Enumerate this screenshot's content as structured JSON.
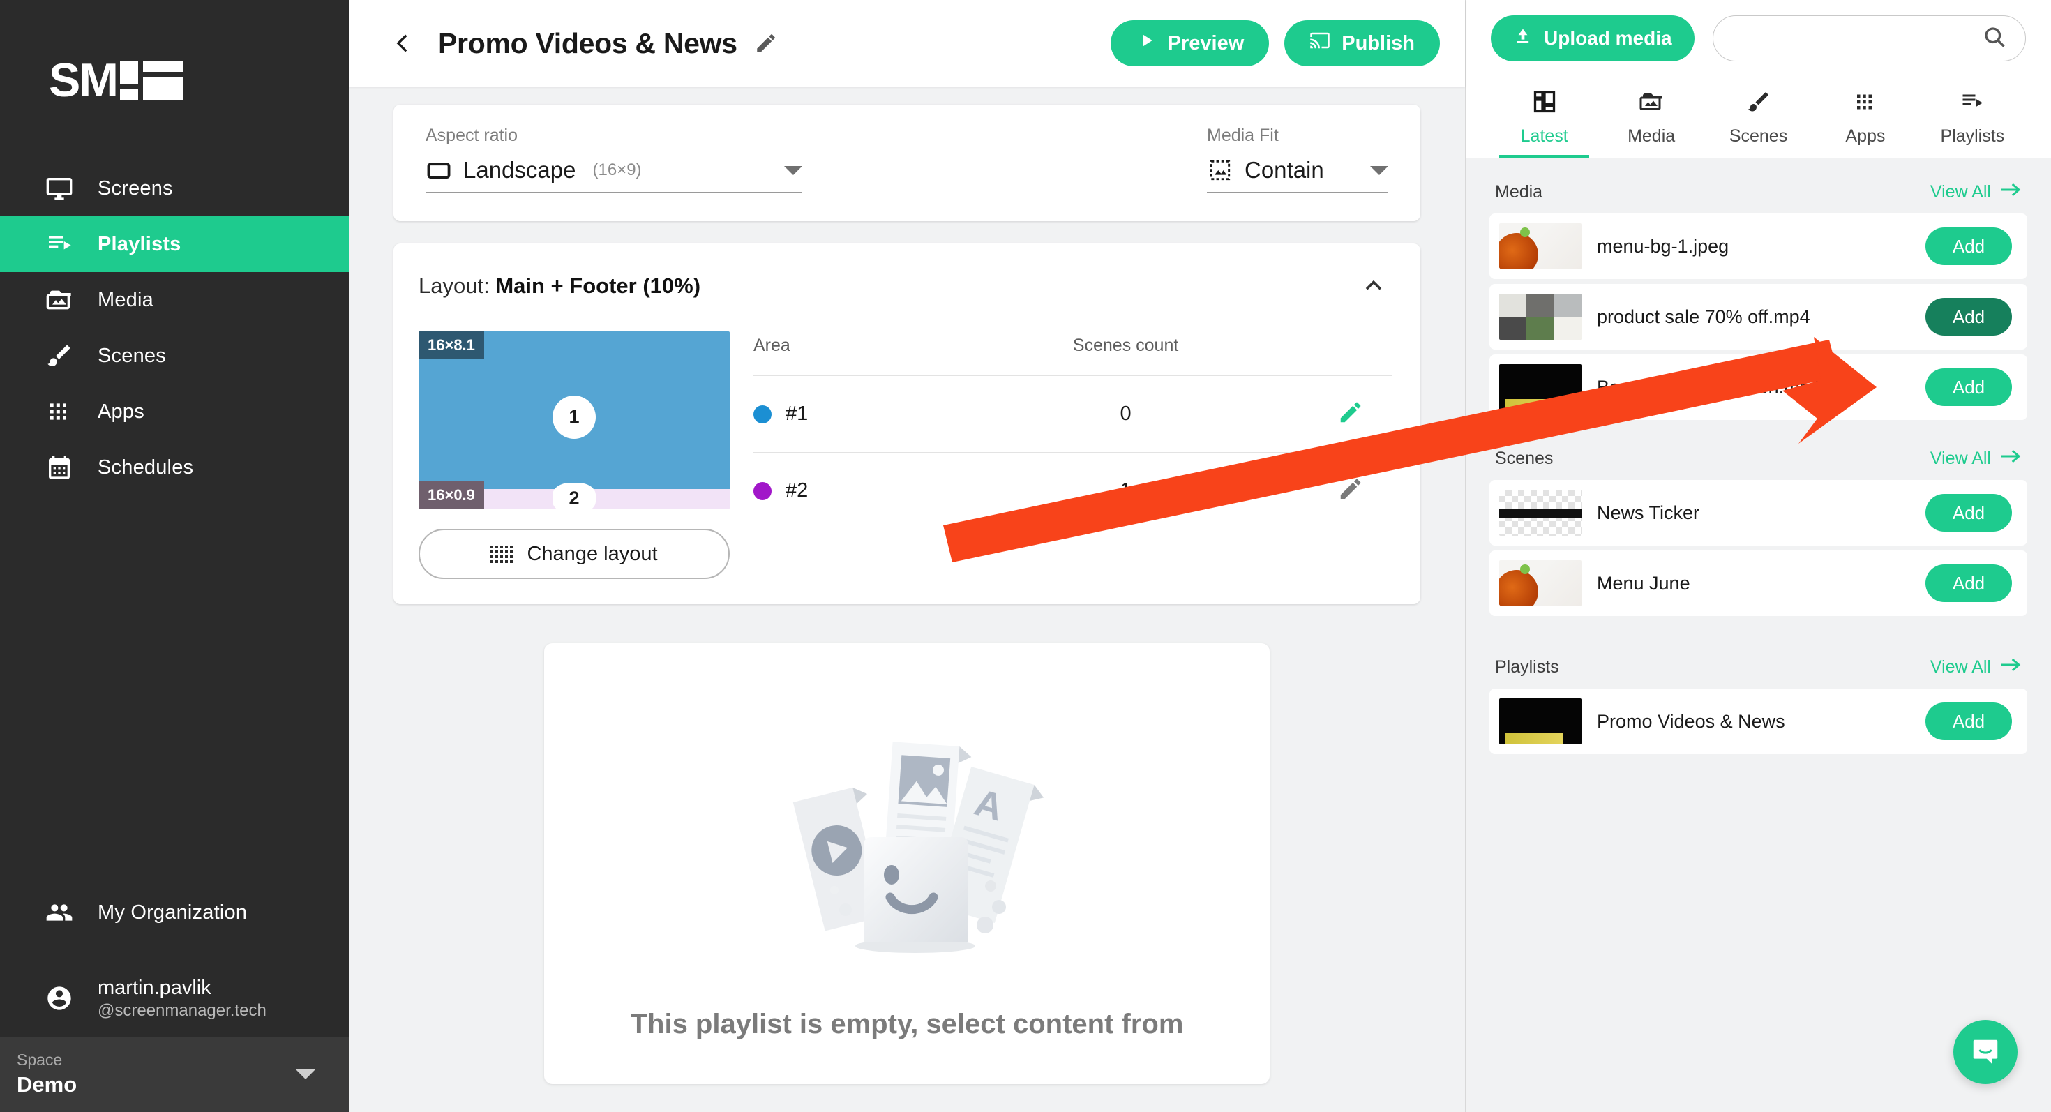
{
  "brand": {
    "logo_text": "SM",
    "accent": "#1ecb8e"
  },
  "sidebar": {
    "items": [
      {
        "label": "Screens",
        "icon": "monitor-icon"
      },
      {
        "label": "Playlists",
        "icon": "playlist-icon"
      },
      {
        "label": "Media",
        "icon": "media-folder-icon"
      },
      {
        "label": "Scenes",
        "icon": "brush-icon"
      },
      {
        "label": "Apps",
        "icon": "apps-grid-icon"
      },
      {
        "label": "Schedules",
        "icon": "calendar-icon"
      }
    ],
    "org": {
      "label": "My Organization",
      "icon": "people-icon"
    },
    "user": {
      "name": "martin.pavlik",
      "handle": "@screenmanager.tech",
      "icon": "account-circle-icon"
    },
    "space": {
      "label": "Space",
      "value": "Demo"
    }
  },
  "header": {
    "back_icon": "chevron-left-icon",
    "title": "Promo Videos & News",
    "edit_icon": "pencil-icon",
    "preview_label": "Preview",
    "publish_label": "Publish"
  },
  "settings": {
    "aspect_ratio_label": "Aspect ratio",
    "aspect_ratio_value": "Landscape",
    "aspect_ratio_sub": "(16×9)",
    "media_fit_label": "Media Fit",
    "media_fit_value": "Contain"
  },
  "layout": {
    "prefix": "Layout:",
    "name": "Main + Footer (10%)",
    "thumb": {
      "zone1_badge": "16×8.1",
      "zone1_number": "1",
      "zone2_badge": "16×0.9",
      "zone2_number": "2"
    },
    "change_layout_label": "Change layout",
    "table": {
      "columns": [
        "Area",
        "Scenes count",
        ""
      ],
      "rows": [
        {
          "area": "#1",
          "color": "#1b8fd3",
          "scenes_count": "0",
          "edit_icon": "pencil-icon",
          "edit_color": "#1ecb8e"
        },
        {
          "area": "#2",
          "color": "#a117c9",
          "scenes_count": "1",
          "edit_icon": "pencil-icon",
          "edit_color": "#7a7a7a"
        }
      ]
    }
  },
  "empty_state": {
    "illustration": "empty-media-cards-illustration",
    "message": "This playlist is empty, select content from"
  },
  "right_panel": {
    "upload_label": "Upload media",
    "upload_icon": "upload-icon",
    "search": {
      "value": "",
      "placeholder": "",
      "icon": "search-icon"
    },
    "tabs": [
      {
        "label": "Latest",
        "icon": "dashboard-icon",
        "active": true
      },
      {
        "label": "Media",
        "icon": "media-folder-icon",
        "active": false
      },
      {
        "label": "Scenes",
        "icon": "brush-icon",
        "active": false
      },
      {
        "label": "Apps",
        "icon": "apps-grid-icon",
        "active": false
      },
      {
        "label": "Playlists",
        "icon": "playlist-icon",
        "active": false
      }
    ],
    "view_all_label": "View All",
    "sections": [
      {
        "title": "Media",
        "items": [
          {
            "name": "menu-bg-1.jpeg",
            "add_label": "Add",
            "thumb": "food-photo",
            "hover": false
          },
          {
            "name": "product sale 70% off.mp4",
            "add_label": "Add",
            "thumb": "photo-grid",
            "hover": true
          },
          {
            "name": "Best Noodles In Town.mp4",
            "add_label": "Add",
            "thumb": "black-video",
            "hover": false
          }
        ]
      },
      {
        "title": "Scenes",
        "items": [
          {
            "name": "News Ticker",
            "add_label": "Add",
            "thumb": "checker-ticker",
            "hover": false
          },
          {
            "name": "Menu June",
            "add_label": "Add",
            "thumb": "menu-doc",
            "hover": false
          }
        ]
      },
      {
        "title": "Playlists",
        "items": [
          {
            "name": "Promo Videos & News",
            "add_label": "Add",
            "thumb": "black-video",
            "hover": false
          }
        ]
      }
    ]
  },
  "support": {
    "icon": "chat-bubble-icon"
  },
  "annotation": {
    "type": "arrow",
    "color": "#f8431a",
    "points_to": "add-button-product-sale"
  }
}
